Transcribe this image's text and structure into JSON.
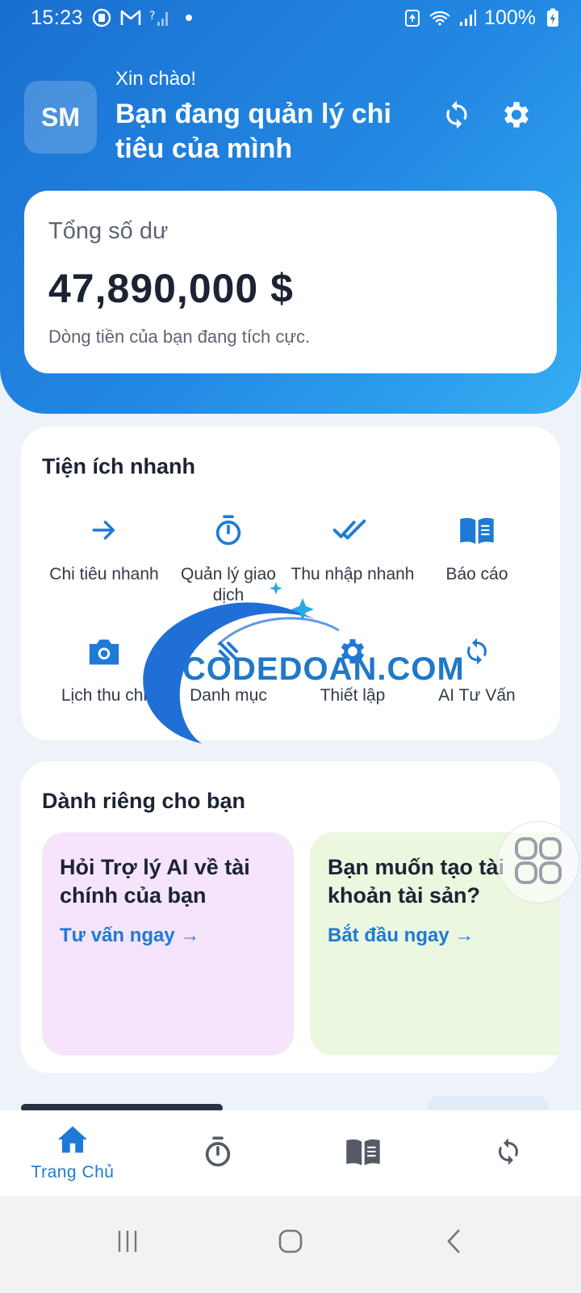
{
  "status_bar": {
    "time": "15:23",
    "battery": "100%"
  },
  "header": {
    "avatar_initials": "SM",
    "greeting": "Xin chào!",
    "headline": "Bạn đang quản lý chi tiêu của mình"
  },
  "balance": {
    "label": "Tổng số dư",
    "value": "47,890,000 $",
    "note": "Dòng tiền của bạn đang tích cực."
  },
  "quick_actions": {
    "title": "Tiện ích nhanh",
    "items": [
      {
        "label": "Chi tiêu nhanh",
        "icon": "arrow-right-icon"
      },
      {
        "label": "Quản lý giao dịch",
        "icon": "stopwatch-icon"
      },
      {
        "label": "Thu nhập nhanh",
        "icon": "double-check-icon"
      },
      {
        "label": "Báo cáo",
        "icon": "book-icon"
      },
      {
        "label": "Lịch thu chi",
        "icon": "camera-icon"
      },
      {
        "label": "Danh mục",
        "icon": "category-icon"
      },
      {
        "label": "Thiết lập",
        "icon": "gear-icon"
      },
      {
        "label": "AI Tư Vấn",
        "icon": "sync-icon"
      }
    ]
  },
  "for_you": {
    "title": "Dành riêng cho bạn",
    "cards": [
      {
        "title": "Hỏi Trợ lý AI về tài chính của bạn",
        "link": "Tư vấn ngay →",
        "bg": "#f5e4fb"
      },
      {
        "title": "Bạn muốn tạo tài khoản tài sản?",
        "link": "Bắt đầu ngay →",
        "bg": "#ebf7df"
      }
    ]
  },
  "bottom_nav": {
    "items": [
      {
        "label": "Trang Chủ",
        "icon": "home-icon",
        "active": true
      },
      {
        "label": "",
        "icon": "stopwatch-icon",
        "active": false
      },
      {
        "label": "",
        "icon": "book-icon",
        "active": false
      },
      {
        "label": "",
        "icon": "sync-icon",
        "active": false
      }
    ]
  },
  "watermark": {
    "text": "CODEDOAN.COM"
  },
  "colors": {
    "primary": "#1e7ad6",
    "header_start": "#1a6fd0",
    "header_end": "#35adf3"
  }
}
